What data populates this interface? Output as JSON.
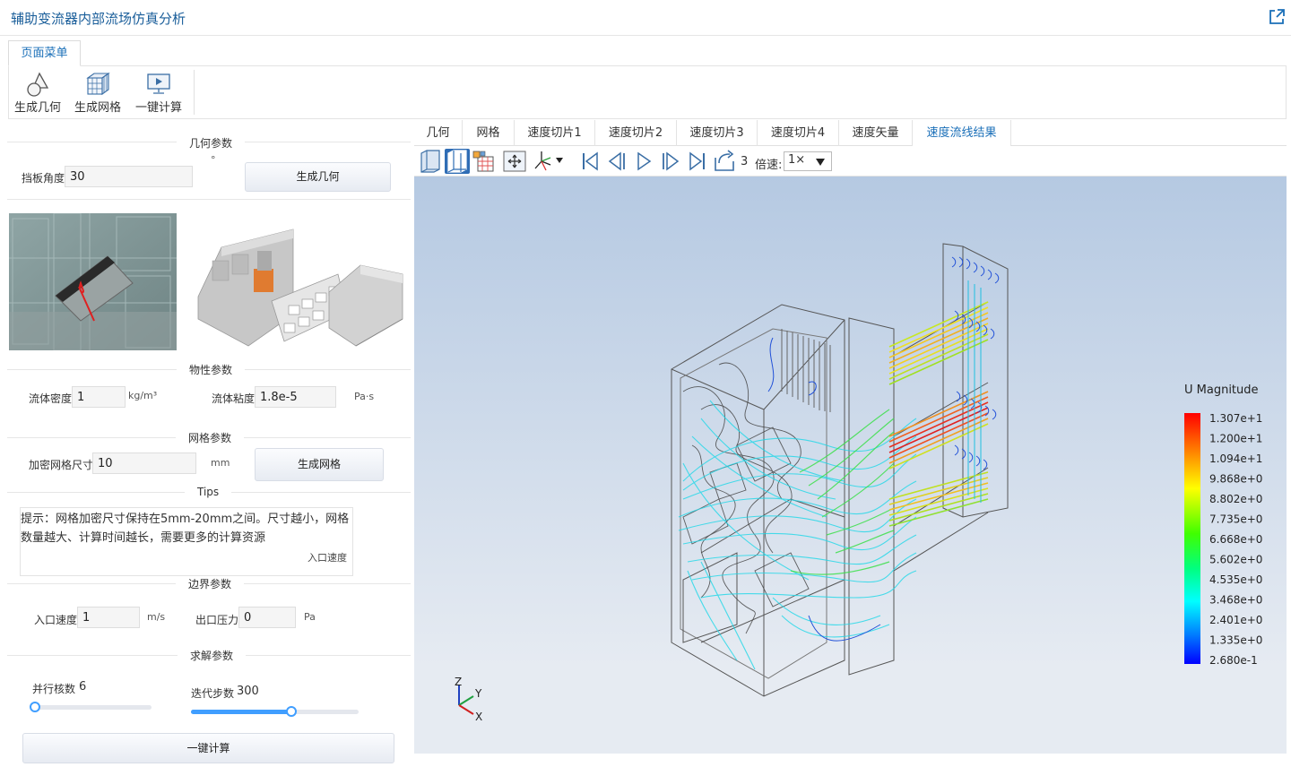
{
  "app": {
    "title": "辅助变流器内部流场仿真分析"
  },
  "menu": {
    "tab_label": "页面菜单"
  },
  "ribbon": {
    "buttons": [
      {
        "label": "生成几何",
        "icon": "geometry-icon"
      },
      {
        "label": "生成网格",
        "icon": "mesh-icon"
      },
      {
        "label": "一键计算",
        "icon": "compute-icon"
      }
    ]
  },
  "geometry": {
    "section_title": "几何参数",
    "baffle_angle_label": "挡板角度",
    "baffle_angle_value": "30",
    "degree_unit": "°",
    "generate_button": "生成几何"
  },
  "material": {
    "section_title": "物性参数",
    "density_label": "流体密度",
    "density_value": "1",
    "density_unit": "kg/m³",
    "viscosity_label": "流体粘度",
    "viscosity_value": "1.8e-5",
    "viscosity_unit": "Pa·s"
  },
  "mesh": {
    "section_title": "网格参数",
    "refine_size_label": "加密网格尺寸",
    "refine_size_value": "10",
    "refine_size_unit": "mm",
    "generate_button": "生成网格"
  },
  "tips": {
    "section_title": "Tips",
    "text": "提示：网格加密尺寸保持在5mm-20mm之间。尺寸越小，网格数量越大、计算时间越长，需要更多的计算资源",
    "sub_label": "入口速度"
  },
  "boundary": {
    "section_title": "边界参数",
    "inlet_velocity_label": "入口速度",
    "inlet_velocity_value": "1",
    "inlet_velocity_unit": "m/s",
    "outlet_pressure_label": "出口压力",
    "outlet_pressure_value": "0",
    "outlet_pressure_unit": "Pa"
  },
  "solver": {
    "section_title": "求解参数",
    "cores_label": "并行核数",
    "cores_value": "6",
    "cores_fraction": 0.0,
    "iterations_label": "迭代步数",
    "iterations_value": "300",
    "iterations_fraction": 0.6,
    "run_button": "一键计算"
  },
  "tabs": [
    "几何",
    "网格",
    "速度切片1",
    "速度切片2",
    "速度切片3",
    "速度切片4",
    "速度矢量",
    "速度流线结果"
  ],
  "active_tab": 7,
  "toolbar": {
    "frame_number": "3",
    "speed_label": "倍速:",
    "speed_value": "1×"
  },
  "legend": {
    "title": "U Magnitude",
    "ticks": [
      "1.307e+1",
      "1.200e+1",
      "1.094e+1",
      "9.868e+0",
      "8.802e+0",
      "7.735e+0",
      "6.668e+0",
      "5.602e+0",
      "4.535e+0",
      "3.468e+0",
      "2.401e+0",
      "1.335e+0",
      "2.680e-1"
    ]
  },
  "axes": {
    "z": "Z",
    "y": "Y",
    "x": "X"
  },
  "colors": {
    "accent": "#1a6fb8",
    "title": "#1a5e9a",
    "slider": "#409eff"
  }
}
